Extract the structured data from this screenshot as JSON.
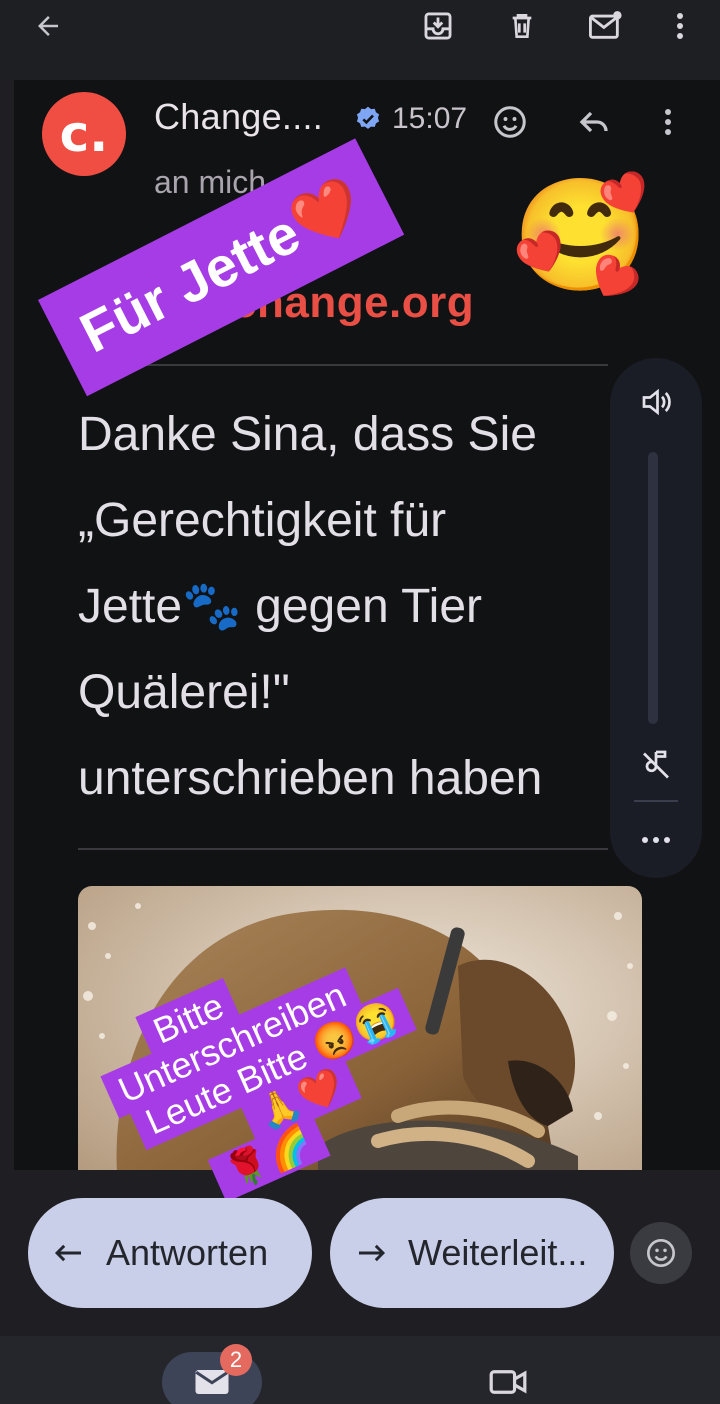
{
  "toolbar": {
    "back_icon": "arrow-left-icon",
    "archive_icon": "archive-icon",
    "delete_icon": "trash-icon",
    "unread_icon": "mark-unread-icon",
    "more_icon": "more-vertical-icon"
  },
  "email": {
    "avatar_letter": "c.",
    "sender": "Change....",
    "time": "15:07",
    "to_line": "an mich",
    "logo_text": "change.org",
    "body_lines": [
      "Danke Sina, dass Sie",
      "„Gerechtigkeit für",
      "Jette🐾 gegen Tier",
      "Quälerei!\"",
      "unterschrieben haben"
    ]
  },
  "stickers": {
    "fuer_jette": "Für Jette❤️",
    "hug_emoji": "🥰",
    "bitte_lines": [
      "Bitte",
      "Unterschreiben",
      "Leute Bitte 😡😭",
      "🙏❤️",
      "🌹🌈"
    ]
  },
  "reply_bar": {
    "reply_label": "Antworten",
    "forward_label": "Weiterleit..."
  },
  "nav": {
    "mail_badge": "2"
  },
  "colors": {
    "brand": "#e94f45",
    "sticker": "#a63ce6",
    "pill": "#c9cfe8"
  }
}
